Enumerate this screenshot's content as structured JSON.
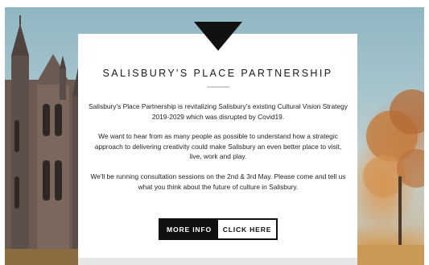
{
  "banner": {
    "title": "SALISBURY'S PLACE PARTNERSHIP",
    "paragraphs": [
      "Salisbury's Place Partnership is revitalizing Salisbury's existing Cultural Vision Strategy 2019-2029 which was disrupted by Covid19.",
      "We want to hear from as many people as possible to understand how a strategic approach to delivering creativity could make Salisbury an even better place to visit, live, work and play.",
      "We'll be running consultation sessions on the 2nd & 3rd May. Please come and tell us what you think about the future of culture in Salisbury."
    ],
    "buttons": {
      "more_info": "MORE INFO",
      "click_here": "CLICK HERE"
    }
  },
  "colors": {
    "button_dark": "#111111",
    "card": "#ffffff",
    "notch": "#111111"
  }
}
